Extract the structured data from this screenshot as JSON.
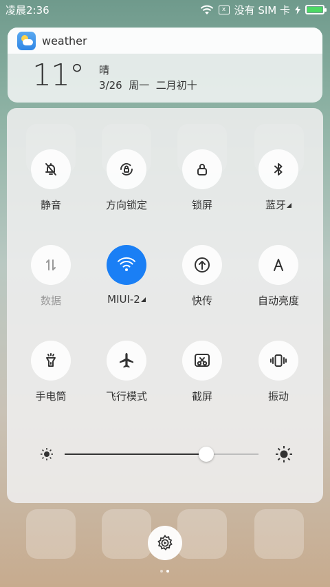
{
  "status_bar": {
    "time": "凌晨2:36",
    "carrier": "没有 SIM 卡",
    "sim_glyph": "x"
  },
  "weather": {
    "app_name": "weather",
    "temperature": "11°",
    "condition": "晴",
    "date_line": "3/26  周一  二月初十"
  },
  "toggles": [
    {
      "label": "静音",
      "icon": "bell-off-icon",
      "active": false
    },
    {
      "label": "方向锁定",
      "icon": "rotation-lock-icon",
      "active": false
    },
    {
      "label": "锁屏",
      "icon": "lock-icon",
      "active": false
    },
    {
      "label": "蓝牙",
      "icon": "bluetooth-icon",
      "active": false,
      "has_more": true
    },
    {
      "label": "数据",
      "icon": "mobile-data-icon",
      "active": false,
      "disabled": true
    },
    {
      "label": "MIUI-2",
      "icon": "wifi-icon",
      "active": true,
      "has_more": true
    },
    {
      "label": "快传",
      "icon": "quick-transfer-icon",
      "active": false
    },
    {
      "label": "自动亮度",
      "icon": "auto-brightness-icon",
      "active": false
    },
    {
      "label": "手电筒",
      "icon": "flashlight-icon",
      "active": false
    },
    {
      "label": "飞行模式",
      "icon": "airplane-icon",
      "active": false
    },
    {
      "label": "截屏",
      "icon": "screenshot-icon",
      "active": false
    },
    {
      "label": "振动",
      "icon": "vibrate-icon",
      "active": false
    }
  ],
  "brightness": {
    "level": 0.73
  },
  "colors": {
    "accent": "#1a7ff5",
    "battery": "#4cd964"
  },
  "pager": {
    "pages": 2,
    "current": 2
  }
}
